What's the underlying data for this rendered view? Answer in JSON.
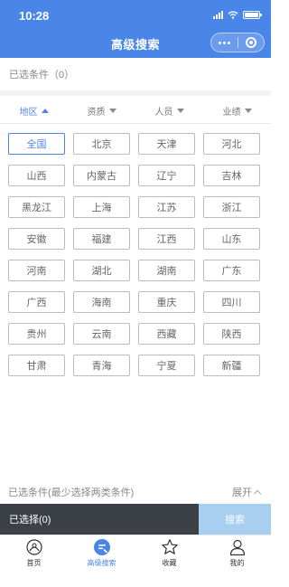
{
  "status_bar": {
    "time": "10:28"
  },
  "header": {
    "title": "高级搜索",
    "more_icon": "more-dots-icon",
    "close_icon": "target-icon"
  },
  "selected_top": "已选条件（0）",
  "filter_tabs": [
    {
      "label": "地区",
      "active": true,
      "icon": "caret-up-icon"
    },
    {
      "label": "资质",
      "active": false,
      "icon": "caret-down-icon"
    },
    {
      "label": "人员",
      "active": false,
      "icon": "caret-down-icon"
    },
    {
      "label": "业绩",
      "active": false,
      "icon": "caret-down-icon"
    }
  ],
  "provinces": [
    "全国",
    "北京",
    "天津",
    "河北",
    "山西",
    "内蒙古",
    "辽宁",
    "吉林",
    "黑龙江",
    "上海",
    "江苏",
    "浙江",
    "安徽",
    "福建",
    "江西",
    "山东",
    "河南",
    "湖北",
    "湖南",
    "广东",
    "广西",
    "海南",
    "重庆",
    "四川",
    "贵州",
    "云南",
    "西藏",
    "陕西",
    "甘肃",
    "青海",
    "宁夏",
    "新疆"
  ],
  "selected_province": "全国",
  "conditions": {
    "label": "已选条件(最少选择两类条件)",
    "expand": "展开"
  },
  "action_bar": {
    "selected": "已选择(0)",
    "search": "搜索"
  },
  "tab_bar": [
    {
      "label": "首页",
      "icon": "home-icon",
      "active": false
    },
    {
      "label": "高级搜索",
      "icon": "advanced-search-icon",
      "active": true
    },
    {
      "label": "收藏",
      "icon": "star-icon",
      "active": false
    },
    {
      "label": "我的",
      "icon": "user-icon",
      "active": false
    }
  ],
  "colors": {
    "primary": "#4a86e8",
    "action_dark": "#3c4148",
    "search_btn": "#a8cff0"
  }
}
